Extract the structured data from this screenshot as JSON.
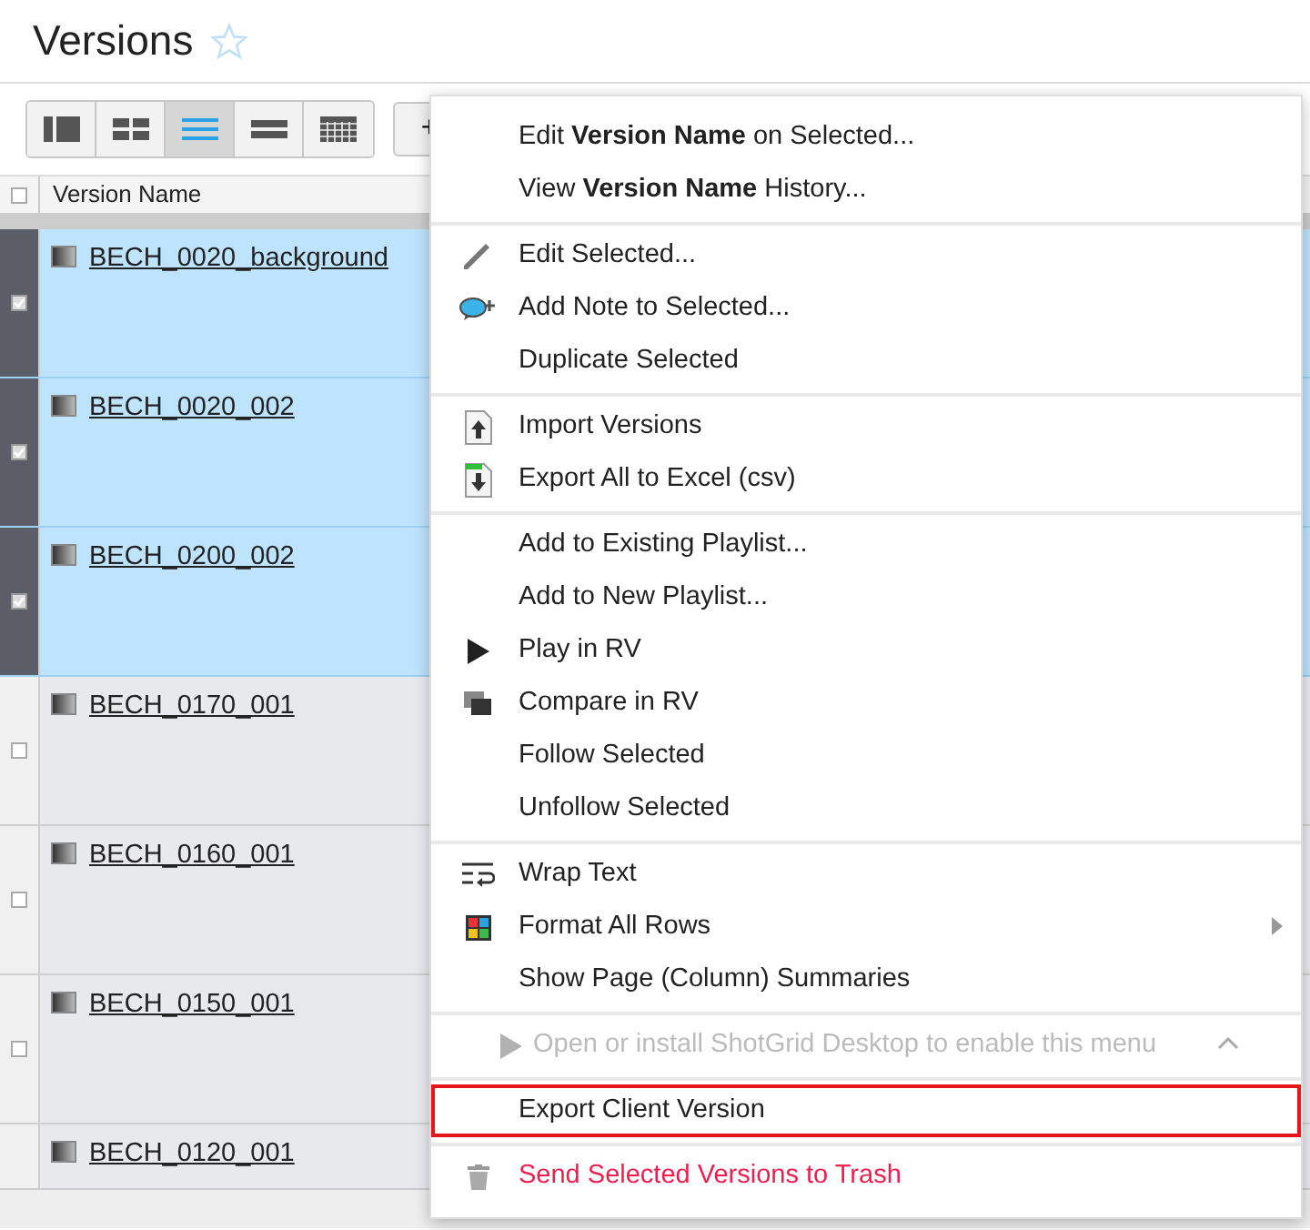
{
  "page": {
    "title": "Versions",
    "favorite": false
  },
  "toolbar": {
    "views": [
      {
        "kind": "panel",
        "selected": false
      },
      {
        "kind": "grid",
        "selected": false
      },
      {
        "kind": "list",
        "selected": true
      },
      {
        "kind": "rows",
        "selected": false
      },
      {
        "kind": "calendar",
        "selected": false
      }
    ],
    "add_label": "+"
  },
  "table": {
    "select_all": false,
    "columns": [
      "Version Name"
    ],
    "rows": [
      {
        "name": "BECH_0020_background",
        "selected": true
      },
      {
        "name": "BECH_0020_002",
        "selected": true
      },
      {
        "name": "BECH_0200_002",
        "selected": true
      },
      {
        "name": "BECH_0170_001",
        "selected": false
      },
      {
        "name": "BECH_0160_001",
        "selected": false
      },
      {
        "name": "BECH_0150_001",
        "selected": false
      },
      {
        "name": "BECH_0120_001",
        "selected": false
      }
    ]
  },
  "context_menu": {
    "sections": [
      [
        {
          "label": "Edit **Version Name** on Selected..."
        },
        {
          "label": "View **Version Name** History..."
        }
      ],
      [
        {
          "label": "Edit Selected...",
          "kind": "pencil"
        },
        {
          "label": "Add Note to Selected...",
          "kind": "note"
        },
        {
          "label": "Duplicate Selected"
        }
      ],
      [
        {
          "label": "Import Versions",
          "kind": "import"
        },
        {
          "label": "Export All to Excel (csv)",
          "kind": "export"
        }
      ],
      [
        {
          "label": "Add to Existing Playlist..."
        },
        {
          "label": "Add to New Playlist..."
        },
        {
          "label": "Play in RV",
          "kind": "play"
        },
        {
          "label": "Compare in RV",
          "kind": "compare"
        },
        {
          "label": "Follow Selected"
        },
        {
          "label": "Unfollow Selected"
        }
      ],
      [
        {
          "label": "Wrap Text",
          "kind": "wrap"
        },
        {
          "label": "Format All Rows",
          "kind": "format",
          "submenu": true
        },
        {
          "label": "Show Page (Column) Summaries"
        }
      ],
      [
        {
          "label": "Open or install ShotGrid Desktop to enable this menu",
          "kind": "play",
          "disabled": true,
          "collapse": true
        }
      ],
      [
        {
          "label": "Export Client  Version",
          "outlined": true
        }
      ],
      [
        {
          "label": "Send Selected Versions to Trash",
          "kind": "danger"
        }
      ]
    ]
  }
}
